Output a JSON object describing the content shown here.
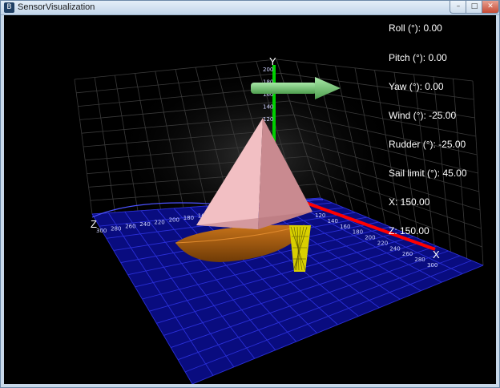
{
  "window": {
    "title": "SensorVisualization",
    "app_icon_glyph": "B",
    "controls": {
      "minimize": "–",
      "maximize": "□",
      "close": "✕"
    }
  },
  "readouts": {
    "roll": "Roll (°): 0.00",
    "pitch": "Pitch (°): 0.00",
    "yaw": "Yaw (°): 0.00",
    "wind": "Wind (°): -25.00",
    "rudder": "Rudder (°): -25.00",
    "sail_limit": "Sail limit (°): 45.00",
    "x": "X: 150.00",
    "z": "Z: 150.00"
  },
  "scene": {
    "axis_labels": {
      "x": "X",
      "y": "Y",
      "z": "Z"
    },
    "y_ticks": [
      "200",
      "180",
      "160",
      "140",
      "120"
    ],
    "x_ticks": [
      "120",
      "140",
      "160",
      "180",
      "200",
      "220",
      "240",
      "260",
      "280",
      "300"
    ],
    "z_ticks": [
      "300",
      "280",
      "260",
      "240",
      "220",
      "200",
      "180",
      "160",
      "140",
      "120"
    ],
    "colors": {
      "background": "#000000",
      "water_grid": "#2a2fd8",
      "water_fill": "#0a0d8a",
      "wall_grid": "#3c3c3c",
      "x_axis": "#ff0000",
      "y_axis": "#00d000",
      "wind_arrow": "#7ed07e",
      "sail": "#e2a4a8",
      "hull": "#b3620d",
      "rudder": "#e0d800"
    }
  }
}
